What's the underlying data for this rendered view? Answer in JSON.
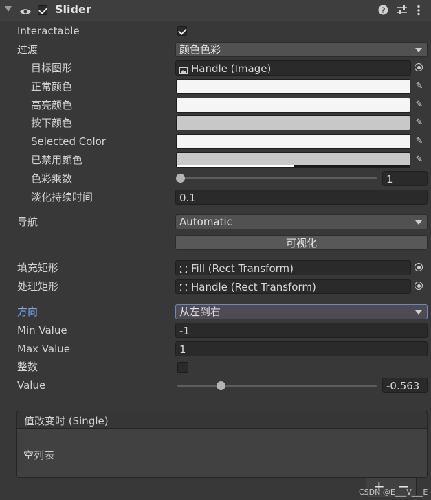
{
  "header": {
    "title": "Slider",
    "enabled": true
  },
  "fields": {
    "interactable_label": "Interactable",
    "interactable_checked": true,
    "transition_label": "过渡",
    "transition_value": "颜色色彩",
    "target_graphic_label": "目标图形",
    "target_graphic_value": "Handle (Image)",
    "normal_color_label": "正常颜色",
    "highlighted_color_label": "高亮颜色",
    "pressed_color_label": "按下颜色",
    "selected_color_label": "Selected Color",
    "disabled_color_label": "已禁用颜色",
    "color_multiplier_label": "色彩乘数",
    "color_multiplier_value": "1",
    "fade_duration_label": "淡化持续时间",
    "fade_duration_value": "0.1",
    "navigation_label": "导航",
    "navigation_value": "Automatic",
    "visualize_label": "可视化",
    "fill_rect_label": "填充矩形",
    "fill_rect_value": "Fill (Rect Transform)",
    "handle_rect_label": "处理矩形",
    "handle_rect_value": "Handle (Rect Transform)",
    "direction_label": "方向",
    "direction_value": "从左到右",
    "min_value_label": "Min Value",
    "min_value_value": "-1",
    "max_value_label": "Max Value",
    "max_value_value": "1",
    "whole_numbers_label": "整数",
    "whole_numbers_checked": false,
    "value_label": "Value",
    "value_value": "-0.563"
  },
  "colors": {
    "normal": "#f5f5f5",
    "highlighted": "#f5f5f5",
    "pressed": "#c8c8c8",
    "selected": "#f5f5f5",
    "disabled": "#c8c8c8"
  },
  "slider_levels": {
    "color_multiplier_fraction": 0.0,
    "value_fraction": 0.2185
  },
  "event": {
    "title": "值改变时 (Single)",
    "empty_label": "空列表",
    "add_label": "+",
    "remove_label": "−"
  },
  "icons": {
    "header": [
      "eye-icon",
      "help-icon",
      "preset-icon",
      "more-icon"
    ],
    "picker": "eyedropper-icon",
    "object_image": "image-icon",
    "object_rect": "rect-transform-icon",
    "target": "object-picker-icon"
  },
  "watermark": "CSDN @E___V___E"
}
